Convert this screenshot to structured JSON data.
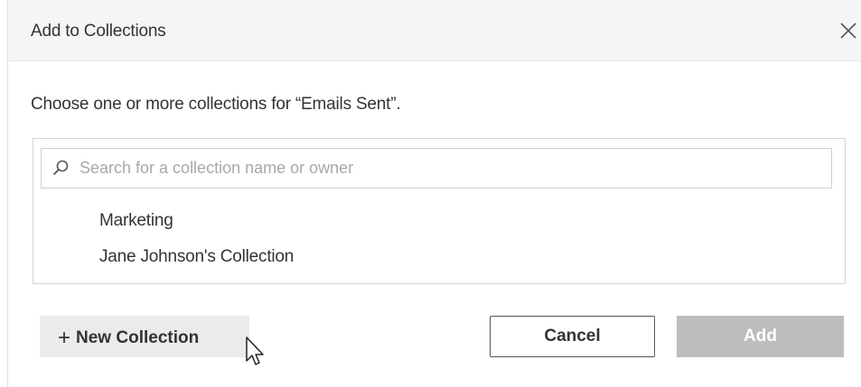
{
  "dialog": {
    "title": "Add to Collections",
    "close_icon": "close-icon",
    "prompt": "Choose one or more collections for “Emails Sent”."
  },
  "search": {
    "placeholder": "Search for a collection name or owner",
    "value": "",
    "icon": "search-icon"
  },
  "collections": [
    {
      "label": "Marketing"
    },
    {
      "label": "Jane Johnson's Collection"
    }
  ],
  "footer": {
    "new_label": "New Collection",
    "new_icon": "plus-icon",
    "cancel_label": "Cancel",
    "add_label": "Add",
    "add_enabled": false
  },
  "colors": {
    "header_bg": "#f5f5f5",
    "text": "#333333",
    "add_disabled_bg": "#bdbdbd",
    "new_button_bg": "#ebebeb"
  }
}
